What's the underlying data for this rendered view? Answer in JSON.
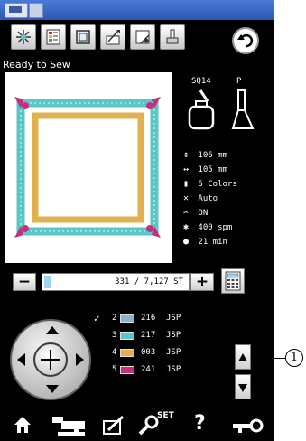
{
  "screen": {
    "status_text": "Ready to Sew"
  },
  "toolbar": {
    "tools": [
      "thread-pattern-icon",
      "color-list-icon",
      "frame-icon",
      "trace-icon",
      "corner-icon",
      "presser-foot-icon"
    ],
    "back_icon": "back-arrow-icon"
  },
  "design_info": {
    "stitch_code": "SQ14",
    "foot_code": "P",
    "height": "106 mm",
    "width": "105 mm",
    "colors": "5 Colors",
    "tension": "Auto",
    "cutter": "ON",
    "speed": "400 spm",
    "time": "21 min"
  },
  "stitch_counter": {
    "text": "331 / 7,127 ST",
    "minus_label": "−",
    "plus_label": "+",
    "progress": 0.046
  },
  "threads": [
    {
      "index": "2",
      "code": "216",
      "brand": "JSP",
      "color": "#8fb1cc",
      "checked": true
    },
    {
      "index": "3",
      "code": "217",
      "brand": "JSP",
      "color": "#5bc6c6",
      "checked": false
    },
    {
      "index": "4",
      "code": "003",
      "brand": "JSP",
      "color": "#e3b04f",
      "checked": false
    },
    {
      "index": "5",
      "code": "241",
      "brand": "JSP",
      "color": "#c2317e",
      "checked": false
    }
  ],
  "check_mark": "✓",
  "callout": "1",
  "nav": {
    "set_label": "SET",
    "help_label": "?",
    "icons": [
      "home-icon",
      "machine-icon",
      "edit-icon",
      "settings-icon",
      "help-icon",
      "key-icon"
    ]
  },
  "colors": {
    "titlebar": "#2b58b3",
    "frame_outer": "#5bc6c6",
    "frame_inner": "#e3b04f",
    "corner_accent": "#c2317e"
  }
}
